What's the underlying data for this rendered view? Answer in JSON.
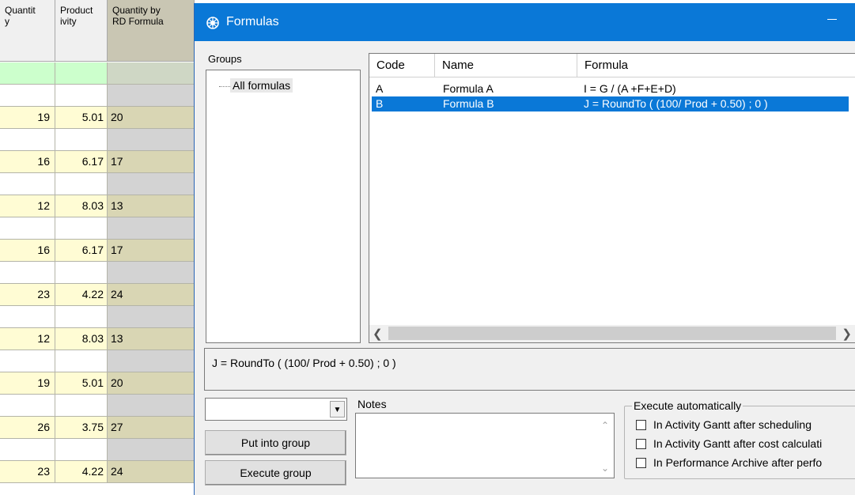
{
  "grid": {
    "headers": [
      "Quantit\ny",
      "Product\nivity",
      "Quantity by\nRD Formula"
    ],
    "rows": [
      {
        "type": "green",
        "quantity": "",
        "productivity": "",
        "rd": ""
      },
      {
        "type": "blank",
        "quantity": "",
        "productivity": "",
        "rd": ""
      },
      {
        "type": "data",
        "quantity": "19",
        "productivity": "5.01",
        "rd": "20"
      },
      {
        "type": "blank",
        "quantity": "",
        "productivity": "",
        "rd": ""
      },
      {
        "type": "data",
        "quantity": "16",
        "productivity": "6.17",
        "rd": "17"
      },
      {
        "type": "blank",
        "quantity": "",
        "productivity": "",
        "rd": ""
      },
      {
        "type": "data",
        "quantity": "12",
        "productivity": "8.03",
        "rd": "13"
      },
      {
        "type": "blank",
        "quantity": "",
        "productivity": "",
        "rd": ""
      },
      {
        "type": "data",
        "quantity": "16",
        "productivity": "6.17",
        "rd": "17"
      },
      {
        "type": "blank",
        "quantity": "",
        "productivity": "",
        "rd": ""
      },
      {
        "type": "data",
        "quantity": "23",
        "productivity": "4.22",
        "rd": "24"
      },
      {
        "type": "blank",
        "quantity": "",
        "productivity": "",
        "rd": ""
      },
      {
        "type": "data",
        "quantity": "12",
        "productivity": "8.03",
        "rd": "13"
      },
      {
        "type": "blank",
        "quantity": "",
        "productivity": "",
        "rd": ""
      },
      {
        "type": "data",
        "quantity": "19",
        "productivity": "5.01",
        "rd": "20"
      },
      {
        "type": "blank",
        "quantity": "",
        "productivity": "",
        "rd": ""
      },
      {
        "type": "data",
        "quantity": "26",
        "productivity": "3.75",
        "rd": "27"
      },
      {
        "type": "blank",
        "quantity": "",
        "productivity": "",
        "rd": ""
      },
      {
        "type": "data",
        "quantity": "23",
        "productivity": "4.22",
        "rd": "24"
      }
    ]
  },
  "dialog": {
    "title": "Formulas",
    "icon": "formula-app-icon",
    "groups_label": "Groups",
    "groups": [
      "All formulas"
    ],
    "list": {
      "columns": [
        "Code",
        "Name",
        "Formula"
      ],
      "rows": [
        {
          "code": "A",
          "name": "Formula A",
          "formula": "I = G / (A +F+E+D)",
          "selected": false
        },
        {
          "code": "B",
          "name": "Formula B",
          "formula": "J =  RoundTo ( (100/ Prod + 0.50)  ; 0 )",
          "selected": true
        }
      ]
    },
    "preview": "J =  RoundTo ( (100/ Prod + 0.50)  ; 0 )",
    "group_select_value": "",
    "buttons": {
      "put_into_group": "Put into group",
      "execute_group": "Execute group"
    },
    "notes_label": "Notes",
    "notes_value": "",
    "execute_auto": {
      "label": "Execute automatically",
      "options": [
        {
          "label": "In Activity Gantt after scheduling",
          "checked": false
        },
        {
          "label": "In Activity Gantt after cost calculati",
          "checked": false
        },
        {
          "label": "In Performance Archive after perfo",
          "checked": false
        }
      ]
    },
    "colors": {
      "titlebar": "#0a78d7",
      "selection": "#0a78d7"
    }
  }
}
